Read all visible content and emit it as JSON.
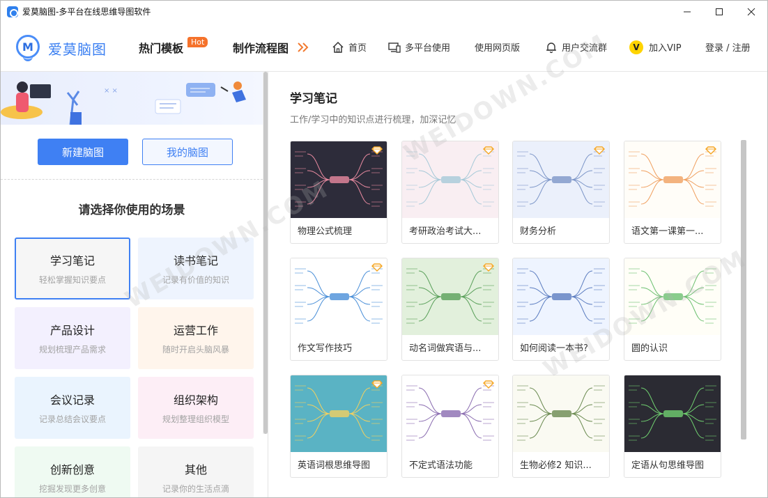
{
  "window": {
    "title": "爱莫脑图-多平台在线思维导图软件",
    "minimize": "—",
    "maximize": "☐",
    "close": "✕"
  },
  "nav": {
    "logo_letter": "M",
    "logo_text": "爱莫脑图",
    "hot_templates": "热门模板",
    "hot_badge": "Hot",
    "flowchart": "制作流程图",
    "flowchart_arrows": "»",
    "home": "首页",
    "multi_platform": "多平台使用",
    "web_version": "使用网页版",
    "user_group": "用户交流群",
    "vip_letter": "V",
    "vip": "加入VIP",
    "login": "登录 / 注册"
  },
  "left": {
    "new_map": "新建脑图",
    "my_maps": "我的脑图",
    "scene_title": "请选择你使用的场景",
    "scenes": [
      {
        "name": "学习笔记",
        "desc": "轻松掌握知识要点",
        "bg": "#f6f6f6"
      },
      {
        "name": "读书笔记",
        "desc": "记录有价值的知识",
        "bg": "#eef4fe"
      },
      {
        "name": "产品设计",
        "desc": "规划梳理产品需求",
        "bg": "#f3f0fe"
      },
      {
        "name": "运营工作",
        "desc": "随时开启头脑风暴",
        "bg": "#fff5ec"
      },
      {
        "name": "会议记录",
        "desc": "记录总结会议要点",
        "bg": "#eaf4fe"
      },
      {
        "name": "组织架构",
        "desc": "规划整理组织模型",
        "bg": "#fdeef6"
      },
      {
        "name": "创新创意",
        "desc": "挖掘发现更多创意",
        "bg": "#effaf2"
      },
      {
        "name": "其他",
        "desc": "记录你的生活点滴",
        "bg": "#f5f5f5"
      }
    ]
  },
  "right": {
    "title": "学习笔记",
    "subtitle": "工作/学习中的知识点进行梳理，加深记忆",
    "cards": [
      {
        "caption": "物理公式梳理",
        "bg": "#2d2c3a",
        "line": "#e88aa0",
        "premium": true
      },
      {
        "caption": "考研政治考试大...",
        "bg": "#f9eef2",
        "line": "#a6c9d8",
        "premium": true
      },
      {
        "caption": "财务分析",
        "bg": "#ebf0fb",
        "line": "#7d96c8",
        "premium": true
      },
      {
        "caption": "语文第一课第一...",
        "bg": "#fffdf8",
        "line": "#f0a060",
        "premium": true
      },
      {
        "caption": "作文写作技巧",
        "bg": "#ffffff",
        "line": "#4a8fd8",
        "premium": true
      },
      {
        "caption": "动名词做宾语与...",
        "bg": "#e2f0dc",
        "line": "#5aa05a",
        "premium": true
      },
      {
        "caption": "如何阅读一本书?",
        "bg": "#eef4ff",
        "line": "#5c7dc0",
        "premium": false
      },
      {
        "caption": "圆的认识",
        "bg": "#fffef7",
        "line": "#6cc070",
        "premium": false
      },
      {
        "caption": "英语词根思维导图",
        "bg": "#5ab3c4",
        "line": "#f2d060",
        "premium": true
      },
      {
        "caption": "不定式语法功能",
        "bg": "#ffffff",
        "line": "#8a6cb0",
        "premium": true
      },
      {
        "caption": "生物必修2 知识...",
        "bg": "#fafaf2",
        "line": "#6a8a50",
        "premium": false
      },
      {
        "caption": "定语从句思维导图",
        "bg": "#2b2b33",
        "line": "#70d070",
        "premium": false
      }
    ]
  },
  "colors": {
    "accent": "#3f80f3",
    "hot": "#f5722b",
    "vip": "#ffd400"
  }
}
